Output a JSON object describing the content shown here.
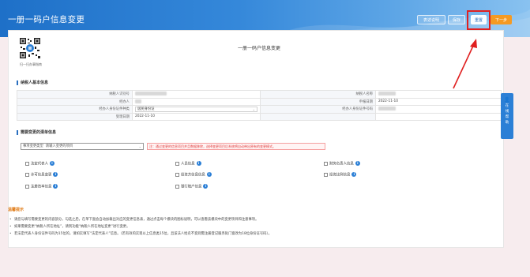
{
  "header": {
    "title": "一册一码户信息变更",
    "buttons": [
      "表述说明",
      "保存",
      "重置",
      "下一步"
    ]
  },
  "form": {
    "title": "一册一码户信息变更",
    "qr_caption": "扫一扫办事指南"
  },
  "taxpayer_section": {
    "title": "纳税人基本信息",
    "rows": [
      {
        "l1": "纳税人识别号",
        "v1": "",
        "l2": "纳税人名称",
        "v2": ""
      },
      {
        "l1": "经办人",
        "v1": "",
        "l2": "申报日期",
        "v2": "2022-11-10"
      },
      {
        "l1": "经办人身份证件种类",
        "v1": "居民身份证",
        "l2": "经办人身份证件号码",
        "v2": ""
      },
      {
        "l1": "受理日期",
        "v1": "2022-11-10",
        "l2": "",
        "v2": ""
      }
    ]
  },
  "change_section": {
    "title": "需要变更的清单信息",
    "type_label": "事项变更类型",
    "type_value": "请输入变更的项目",
    "warning": "注：通过变更的信息项目并且数据移除，选择变更项目后系统将自动带出原有的变更模式。",
    "options": [
      [
        "法定代表人",
        "人员信息",
        "财务负责人信息"
      ],
      [
        "许可信息变更",
        "投资方信息信息",
        "投资比例信息"
      ],
      [
        "注册资本信息",
        "银行账户信息"
      ]
    ]
  },
  "notes": {
    "title": "温馨提示",
    "items": [
      "请您与填写需要变更的内容部分，勾选之后，在单下面会自动加载出对应的变更信息表，通过点击每个模块的图标说明，可以查看该模块中的变更项目和注意事项。",
      "如果需要变更“纳税人所在地址”，请到功能“纳税人所在地址变更”进行变更。",
      "若法定代表人身份证件号码为15位的，请如实填写“法定代表人”信息。（若有效的实现以上信息类15位，且该法人姓名不变则需注册登记服务处门窗改为18位身份证号码）。"
    ]
  },
  "side_tab": {
    "label": "在线帮助"
  }
}
